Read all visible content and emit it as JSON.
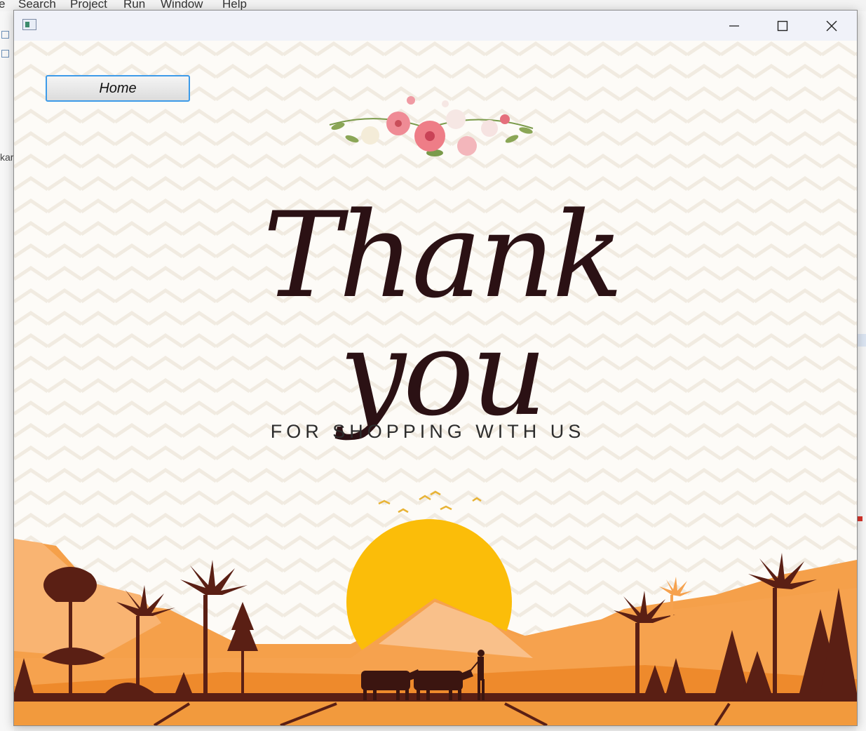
{
  "ide_menu": [
    "e",
    "Search",
    "Project",
    "Run",
    "Window",
    "Help"
  ],
  "ide_side_text": "kar",
  "window": {
    "icon": "java-app-icon",
    "controls": [
      "minimize-icon",
      "maximize-icon",
      "close-icon"
    ]
  },
  "home_button": {
    "label": "Home"
  },
  "card": {
    "title": "Thank you",
    "subtitle": "FOR SHOPPING WITH US",
    "decor": [
      "flower-bouquet",
      "sunset",
      "birds",
      "palm-trees",
      "farmer-with-oxen"
    ]
  },
  "colors": {
    "title": "#2b1114",
    "sun": "#fbbd09",
    "ground": "#f08c2a",
    "silhouette": "#5a1f14",
    "button_border": "#3d9be9"
  }
}
